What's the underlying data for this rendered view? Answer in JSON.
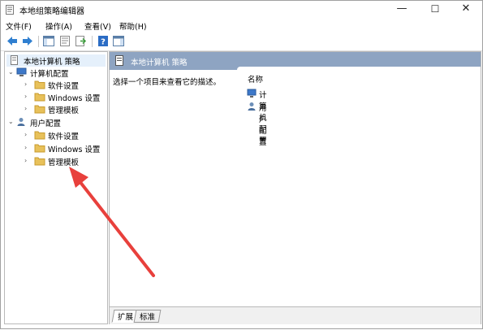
{
  "window": {
    "title": "本地组策略编辑器",
    "controls": {
      "minimize": "—",
      "maximize": "☐",
      "close": "✕"
    }
  },
  "menu": [
    "文件(F)",
    "操作(A)",
    "查看(V)",
    "帮助(H)"
  ],
  "toolbar": [
    "back-arrow-icon",
    "forward-arrow-icon",
    "show-hide-tree-icon",
    "properties-icon",
    "export-list-icon",
    "help-icon",
    "show-hide-action-pane-icon"
  ],
  "tree": {
    "root": "本地计算机 策略",
    "computer": {
      "label": "计算机配置",
      "children": [
        "软件设置",
        "Windows 设置",
        "管理模板"
      ]
    },
    "user": {
      "label": "用户配置",
      "children": [
        "软件设置",
        "Windows 设置",
        "管理模板"
      ]
    }
  },
  "main": {
    "header": "本地计算机 策略",
    "description": "选择一个项目来查看它的描述。",
    "column_name": "名称",
    "items": [
      "计算机配置",
      "用户配置"
    ],
    "tabs": [
      "扩展",
      "标准"
    ]
  },
  "colors": {
    "header_bg": "#8ea4c2",
    "folder": "#e8c15a",
    "annotation_arrow": "#e8403c"
  }
}
